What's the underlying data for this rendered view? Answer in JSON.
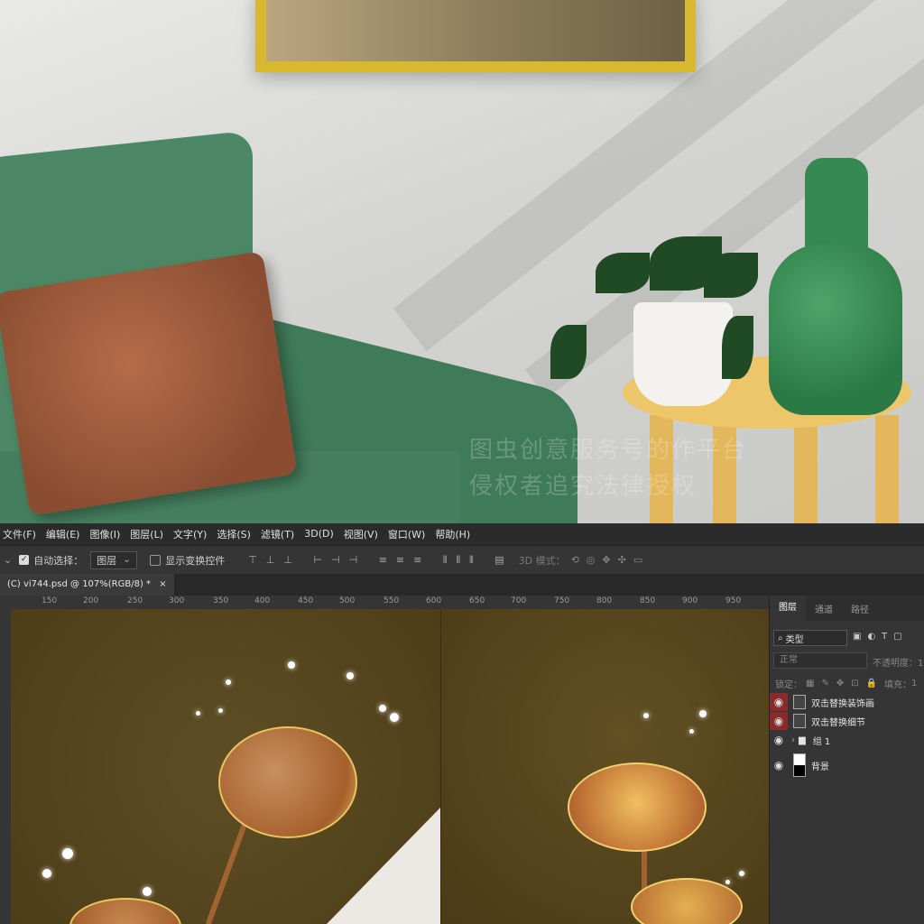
{
  "watermark": {
    "line1": "图虫创意服务号的作平台",
    "line2": "侵权者追究法律授权"
  },
  "menu": [
    "文件(F)",
    "编辑(E)",
    "图像(I)",
    "图层(L)",
    "文字(Y)",
    "选择(S)",
    "滤镜(T)",
    "3D(D)",
    "视图(V)",
    "窗口(W)",
    "帮助(H)"
  ],
  "options": {
    "auto_select_label": "自动选择：",
    "auto_select_value": "图层",
    "show_transform_label": "显示变换控件",
    "mode3d_label": "3D 模式："
  },
  "document": {
    "tab_title": "(C) vi744.psd @ 107%(RGB/8) *",
    "close": "×"
  },
  "ruler": [
    "150",
    "200",
    "250",
    "300",
    "350",
    "400",
    "450",
    "500",
    "550",
    "600",
    "650",
    "700",
    "750",
    "800",
    "850",
    "900",
    "950"
  ],
  "layers_panel": {
    "tabs": [
      "图层",
      "通道",
      "路径"
    ],
    "filter_kind": "类型",
    "blend_mode": "正常",
    "opacity_label": "不透明度：",
    "opacity_value": "1",
    "lock_label": "锁定：",
    "fill_label": "填充：",
    "fill_value": "1",
    "layers": [
      {
        "name": "双击替换装饰画",
        "visible_highlight": true
      },
      {
        "name": "双击替换细节",
        "visible_highlight": true
      },
      {
        "name": "组 1",
        "visible_highlight": false
      },
      {
        "name": "背景",
        "visible_highlight": false
      }
    ]
  }
}
